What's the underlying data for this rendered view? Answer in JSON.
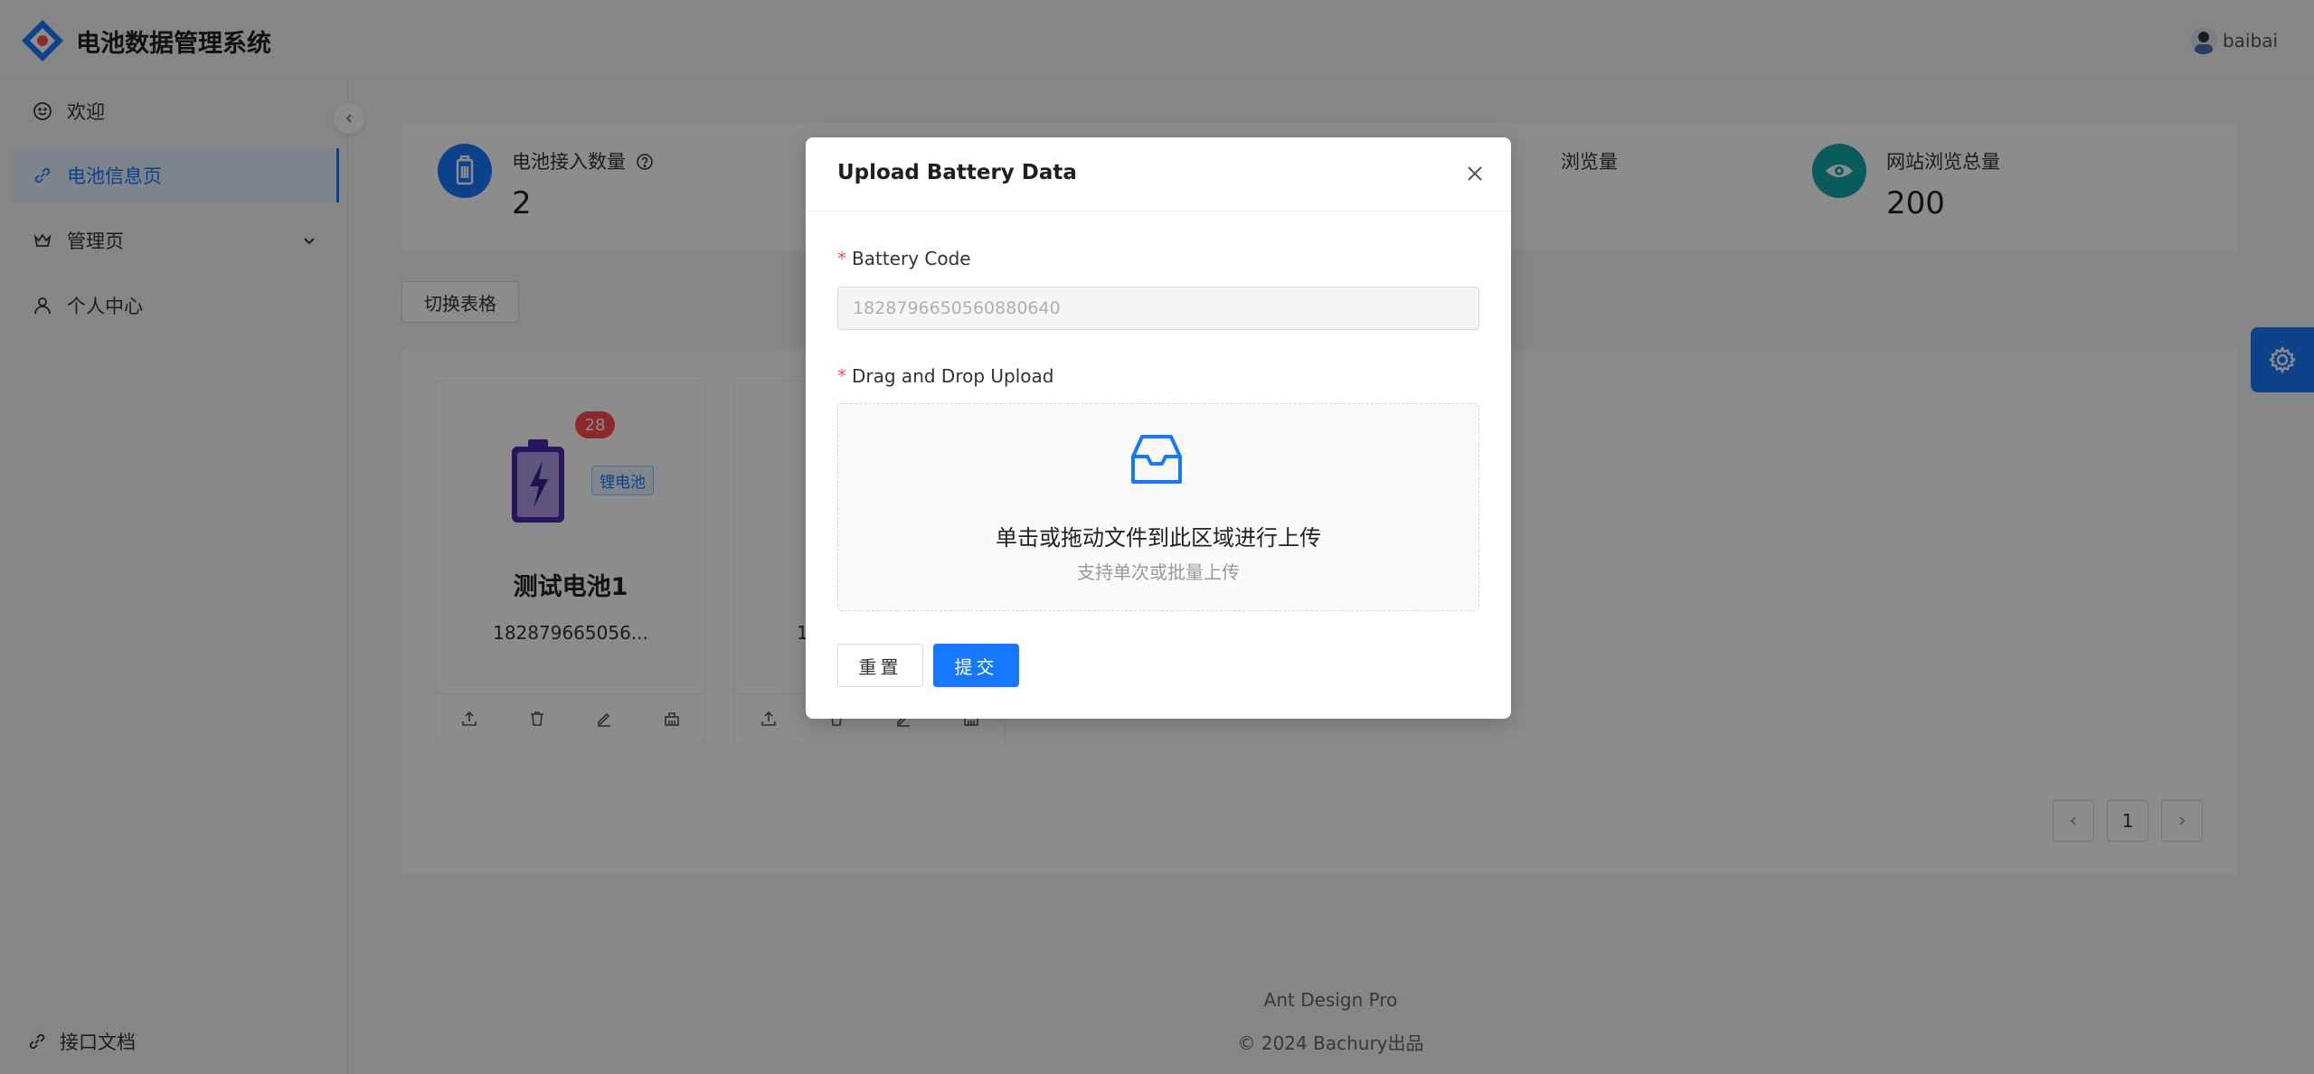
{
  "app": {
    "title": "电池数据管理系统",
    "username": "baibai"
  },
  "sidebar": {
    "items": [
      {
        "label": "欢迎",
        "icon": "smile-icon"
      },
      {
        "label": "电池信息页",
        "icon": "link-icon",
        "active": true
      },
      {
        "label": "管理页",
        "icon": "crown-icon"
      },
      {
        "label": "个人中心",
        "icon": "user-icon"
      }
    ],
    "api_docs": "接口文档"
  },
  "stats": [
    {
      "label": "电池接入数量",
      "value": "2",
      "color": "#1677ff",
      "icon": "battery-icon"
    },
    {
      "label": "浏览量",
      "value": "",
      "color": "#1677ff",
      "icon": "eye-icon"
    },
    {
      "label": "网站浏览总量",
      "value": "200",
      "color": "#13a8a8",
      "icon": "eye-icon"
    }
  ],
  "toolbar": {
    "switch_label": "切换表格"
  },
  "cards": [
    {
      "name": "测试电池1",
      "code": "182879665056...",
      "badge": "28",
      "tag": "锂电池"
    },
    {
      "name": "",
      "code": "1",
      "badge": "",
      "tag": ""
    }
  ],
  "pagination": {
    "current": "1"
  },
  "footer": {
    "line1": "Ant Design Pro",
    "line2": "2024 Bachury出品"
  },
  "modal": {
    "title": "Upload Battery Data",
    "code_label": "Battery Code",
    "code_value": "1828796650560880640",
    "upload_label": "Drag and Drop Upload",
    "drop_text": "单击或拖动文件到此区域进行上传",
    "drop_hint": "支持单次或批量上传",
    "reset_label": "重置",
    "submit_label": "提交"
  },
  "colors": {
    "primary": "#1677ff",
    "badge": "#ff4d4f",
    "teal": "#13a8a8"
  }
}
